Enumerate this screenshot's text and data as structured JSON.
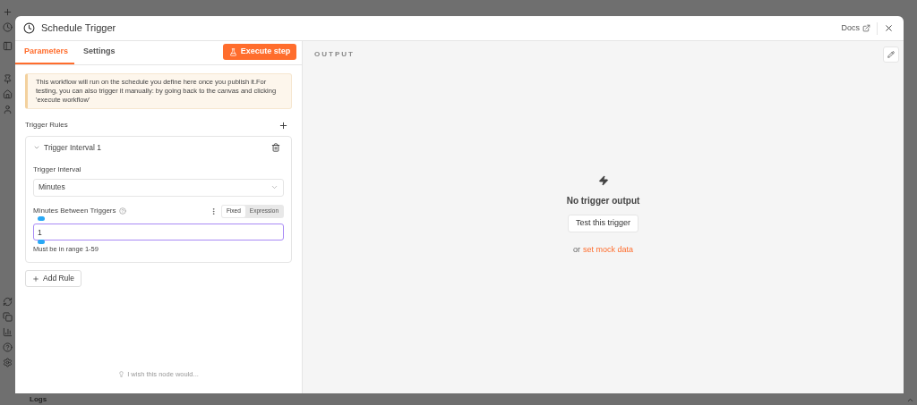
{
  "modal": {
    "title": "Schedule Trigger",
    "docs_link": "Docs"
  },
  "tabs": [
    {
      "label": "Parameters",
      "selected": true
    },
    {
      "label": "Settings",
      "selected": false
    }
  ],
  "execute_button": "Execute step",
  "notice": "This workflow will run on the schedule you define here once you publish it.For testing, you can also trigger it manually: by going back to the canvas and clicking 'execute workflow'",
  "trigger_rules": {
    "label": "Trigger Rules",
    "rules": [
      {
        "title": "Trigger Interval 1",
        "expanded": true,
        "interval_label": "Trigger Interval",
        "interval_value": "Minutes",
        "minutes_label": "Minutes Between Triggers",
        "modes": [
          {
            "label": "Fixed",
            "selected": true
          },
          {
            "label": "Expression",
            "selected": false
          }
        ],
        "minutes_value": "1",
        "hint": "Must be in range 1-59"
      }
    ]
  },
  "add_rule": "Add Rule",
  "feedback": "I wish this node would...",
  "output": {
    "header": "OUTPUT",
    "empty_title": "No trigger output",
    "test_button": "Test this trigger",
    "or": "or",
    "mock_link": "set mock data"
  },
  "logs_bar": "Logs"
}
